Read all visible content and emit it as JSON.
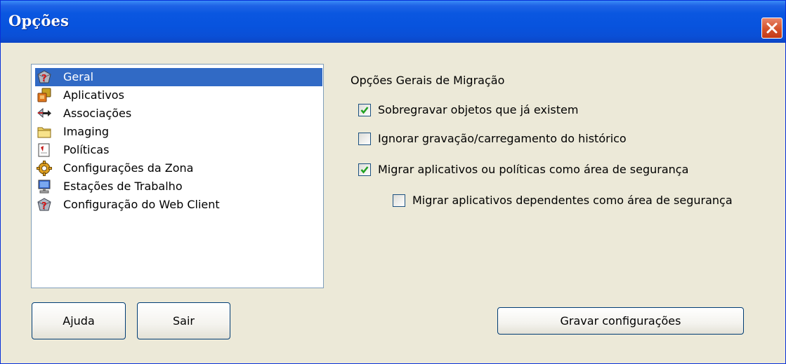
{
  "window": {
    "title": "Opções"
  },
  "list": {
    "items": [
      {
        "label": "Geral",
        "icon": "help-gem-icon",
        "selected": true
      },
      {
        "label": "Aplicativos",
        "icon": "applications-icon",
        "selected": false
      },
      {
        "label": "Associações",
        "icon": "associations-icon",
        "selected": false
      },
      {
        "label": "Imaging",
        "icon": "folder-icon",
        "selected": false
      },
      {
        "label": "Políticas",
        "icon": "policy-icon",
        "selected": false
      },
      {
        "label": "Configurações da Zona",
        "icon": "zone-gear-icon",
        "selected": false
      },
      {
        "label": "Estações de Trabalho",
        "icon": "workstation-icon",
        "selected": false
      },
      {
        "label": "Configuração do Web Client",
        "icon": "web-client-icon",
        "selected": false
      }
    ]
  },
  "buttons": {
    "help": "Ajuda",
    "exit": "Sair",
    "save": "Gravar configurações"
  },
  "options": {
    "section_title": "Opções Gerais de Migração",
    "items": [
      {
        "label": "Sobregravar objetos que já existem",
        "checked": true
      },
      {
        "label": "Ignorar gravação/carregamento do histórico",
        "checked": false
      },
      {
        "label": "Migrar aplicativos ou políticas como área de segurança",
        "checked": true
      },
      {
        "label": "Migrar aplicativos dependentes como área de segurança",
        "checked": false
      }
    ]
  },
  "colors": {
    "titlebar": "#0853de",
    "selection": "#316ac5",
    "dialog_bg": "#ece9d8",
    "close_button": "#d4512a"
  }
}
